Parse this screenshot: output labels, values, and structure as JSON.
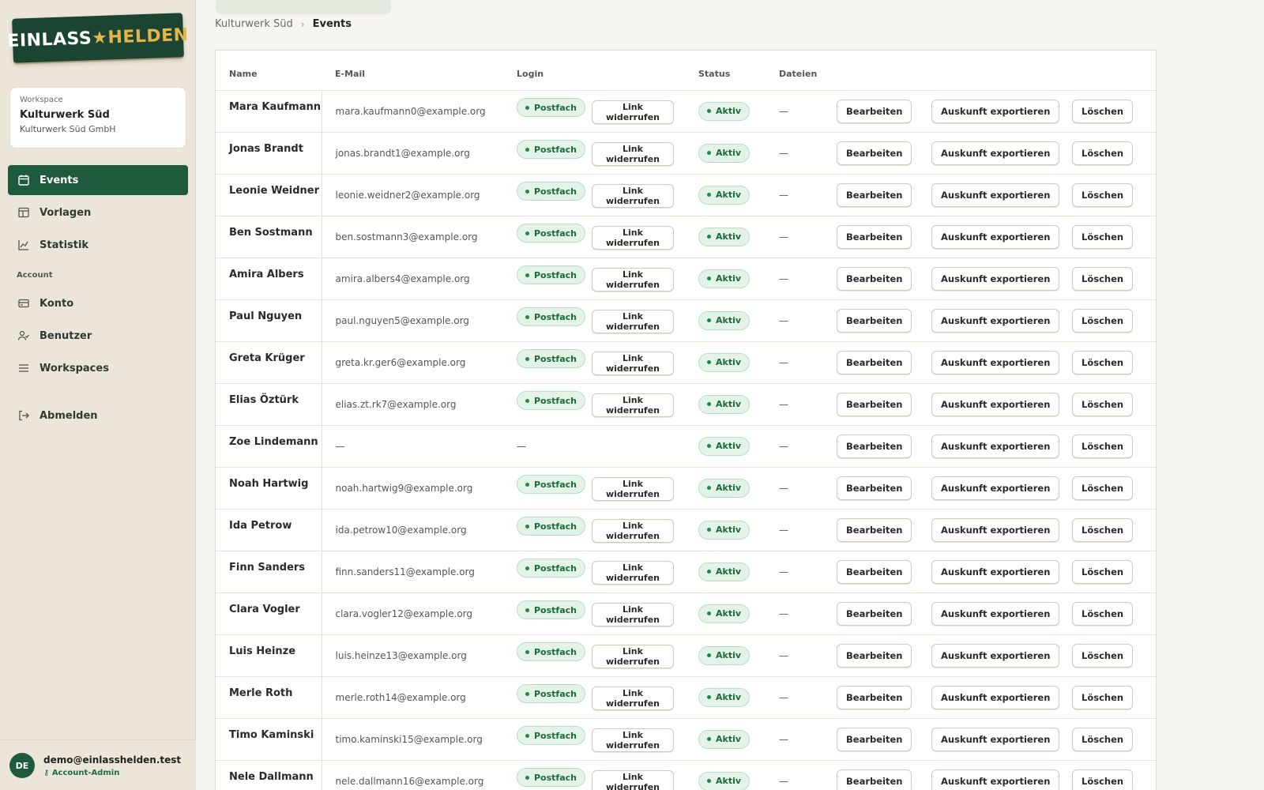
{
  "brand": {
    "logo_left": "EINLASS",
    "logo_star": "★",
    "logo_right": "HELDEN"
  },
  "workspace": {
    "label": "Workspace",
    "name": "Kulturwerk Süd",
    "company": "Kulturwerk Süd GmbH"
  },
  "nav": {
    "main": [
      {
        "label": "Events",
        "icon": "calendar-icon",
        "active": true
      },
      {
        "label": "Vorlagen",
        "icon": "template-icon"
      },
      {
        "label": "Statistik",
        "icon": "chart-icon"
      }
    ],
    "account_label": "Account",
    "account": [
      {
        "label": "Konto",
        "icon": "card-icon"
      },
      {
        "label": "Benutzer",
        "icon": "users-icon"
      },
      {
        "label": "Workspaces",
        "icon": "list-icon"
      }
    ],
    "logout": {
      "label": "Abmelden",
      "icon": "logout-icon"
    }
  },
  "user": {
    "initials": "DE",
    "email": "demo@einlasshelden.test",
    "role": "Account-Admin"
  },
  "breadcrumb": {
    "parent": "Kulturwerk Süd",
    "current": "Events"
  },
  "table": {
    "headers": {
      "name": "Name",
      "email": "E-Mail",
      "login": "Login",
      "status": "Status",
      "files": "Dateien"
    },
    "labels": {
      "postfach": "Postfach",
      "revoke": "Link widerrufen",
      "status": "Aktiv",
      "empty": "—",
      "edit": "Bearbeiten",
      "export": "Auskunft exportieren",
      "delete": "Löschen"
    },
    "rows": [
      {
        "name": "Mara Kaufmann",
        "email": "mara.kaufmann0@example.org",
        "login": true
      },
      {
        "name": "Jonas Brandt",
        "email": "jonas.brandt1@example.org",
        "login": true
      },
      {
        "name": "Leonie Weidner",
        "email": "leonie.weidner2@example.org",
        "login": true
      },
      {
        "name": "Ben Sostmann",
        "email": "ben.sostmann3@example.org",
        "login": true
      },
      {
        "name": "Amira Albers",
        "email": "amira.albers4@example.org",
        "login": true
      },
      {
        "name": "Paul Nguyen",
        "email": "paul.nguyen5@example.org",
        "login": true
      },
      {
        "name": "Greta Krüger",
        "email": "greta.kr.ger6@example.org",
        "login": true
      },
      {
        "name": "Elias Öztürk",
        "email": "elias.zt.rk7@example.org",
        "login": true
      },
      {
        "name": "Zoe Lindemann",
        "email": "—",
        "login": false
      },
      {
        "name": "Noah Hartwig",
        "email": "noah.hartwig9@example.org",
        "login": true
      },
      {
        "name": "Ida Petrow",
        "email": "ida.petrow10@example.org",
        "login": true
      },
      {
        "name": "Finn Sanders",
        "email": "finn.sanders11@example.org",
        "login": true
      },
      {
        "name": "Clara Vogler",
        "email": "clara.vogler12@example.org",
        "login": true
      },
      {
        "name": "Luis Heinze",
        "email": "luis.heinze13@example.org",
        "login": true
      },
      {
        "name": "Merle Roth",
        "email": "merle.roth14@example.org",
        "login": true
      },
      {
        "name": "Timo Kaminski",
        "email": "timo.kaminski15@example.org",
        "login": true
      },
      {
        "name": "Nele Dallmann",
        "email": "nele.dallmann16@example.org",
        "login": true
      }
    ]
  },
  "colors": {
    "brand_green": "#1e5a3e",
    "accent_gold": "#e6b54a",
    "status_green": "#1c6b3b"
  }
}
